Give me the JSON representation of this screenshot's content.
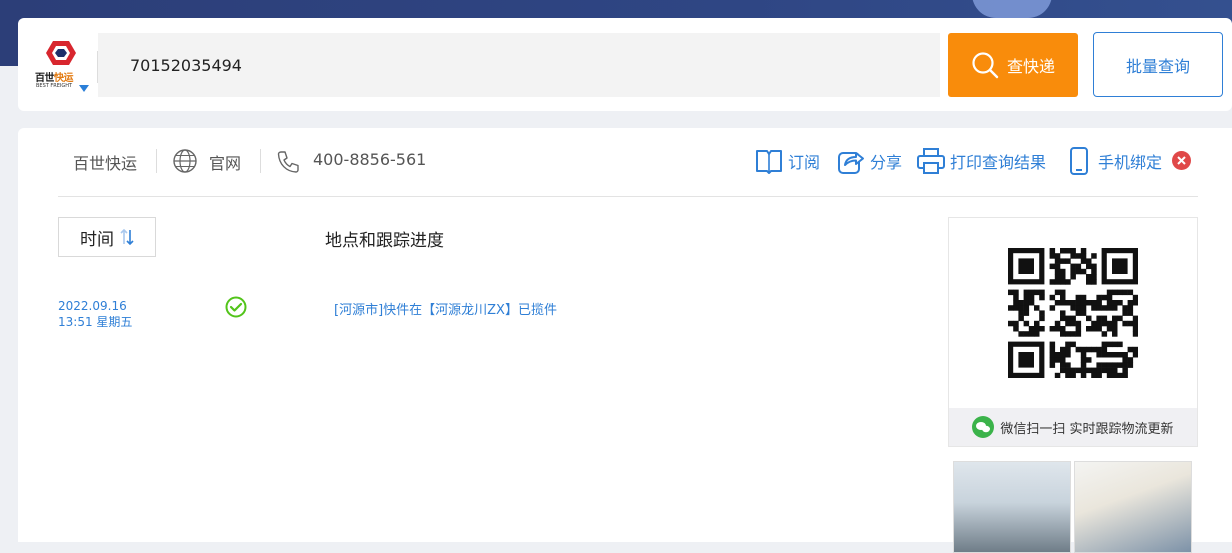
{
  "search": {
    "logo": {
      "cn_black": "百世",
      "cn_orange": "快运",
      "en": "BEST FREIGHT"
    },
    "tracking_number": "70152035494",
    "query_label": "查快递",
    "batch_label": "批量查询"
  },
  "info": {
    "company": "百世快运",
    "site_label": "官网",
    "phone": "400-8856-561"
  },
  "actions": {
    "subscribe": "订阅",
    "share": "分享",
    "print": "打印查询结果",
    "bind_phone": "手机绑定"
  },
  "table": {
    "time_label": "时间",
    "progress_label": "地点和跟踪进度"
  },
  "events": [
    {
      "date": "2022.09.16",
      "time": "13:51 星期五",
      "description": "[河源市]快件在【河源龙川ZX】已揽件"
    }
  ],
  "qr": {
    "caption": "微信扫一扫 实时跟踪物流更新"
  },
  "colors": {
    "accent_blue": "#2f7fd6",
    "query_orange": "#f98c0b",
    "status_green": "#52c41a",
    "close_red": "#e04848"
  }
}
